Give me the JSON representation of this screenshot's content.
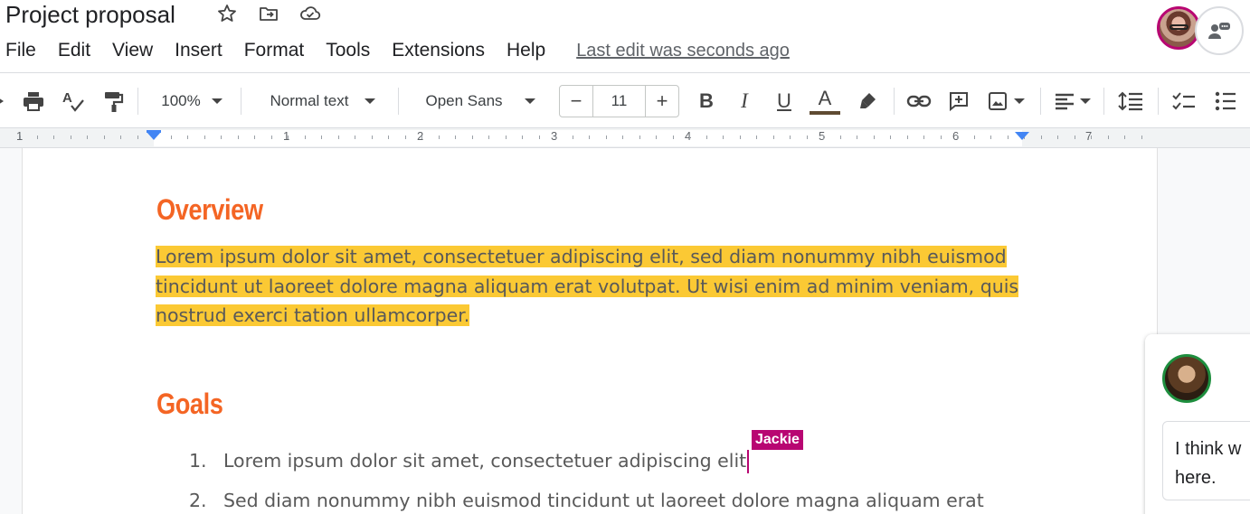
{
  "title": "Project proposal",
  "menu": [
    "File",
    "Edit",
    "View",
    "Insert",
    "Format",
    "Tools",
    "Extensions",
    "Help"
  ],
  "last_edit": "Last edit was seconds ago",
  "toolbar": {
    "zoom": "100%",
    "style": "Normal text",
    "font": "Open Sans",
    "font_size": "11",
    "minus": "−",
    "plus": "+",
    "bold": "B",
    "italic": "I",
    "underline": "U",
    "text_color_glyph": "A",
    "text_color_swatch": "#5f4b32"
  },
  "ruler": {
    "numbers": [
      "1",
      "1",
      "2",
      "3",
      "4",
      "5",
      "6",
      "7"
    ]
  },
  "document": {
    "overview_heading": "Overview",
    "overview_text": "Lorem ipsum dolor sit amet, consectetuer adipiscing elit, sed diam nonummy nibh euismod tincidunt ut laoreet dolore magna aliquam erat volutpat. Ut wisi enim ad minim veniam, quis nostrud exerci tation ullamcorper.",
    "goals_heading": "Goals",
    "goals": [
      {
        "num": "1.",
        "text": "Lorem ipsum dolor sit amet, consectetuer adipiscing elit"
      },
      {
        "num": "2.",
        "text": "Sed diam nonummy nibh euismod tincidunt ut laoreet dolore magna aliquam erat"
      }
    ],
    "collaborator_cursor": "Jackie"
  },
  "comment": {
    "draft_text": "I think w here."
  },
  "colors": {
    "heading": "#f46524",
    "highlight": "#fbc934",
    "collaborator": "#b80672",
    "ruler_marker": "#4285f4"
  }
}
